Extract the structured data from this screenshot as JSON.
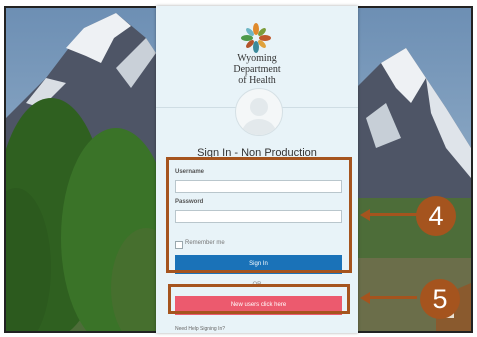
{
  "login": {
    "org_line1": "Wyoming",
    "org_line2": "Department",
    "org_line3": "of Health",
    "title": "Sign In - Non Production",
    "username_label": "Username",
    "password_label": "Password",
    "remember_label": "Remember me",
    "signin_label": "Sign In",
    "or_label": "OR",
    "new_users_label": "New users click here",
    "help_label": "Need Help Signing In?"
  },
  "annotations": {
    "badge_4": "4",
    "badge_5": "5"
  },
  "colors": {
    "annotation": "#a5541e",
    "signin_button": "#1a72b8",
    "new_users_button": "#ec5a6e"
  }
}
